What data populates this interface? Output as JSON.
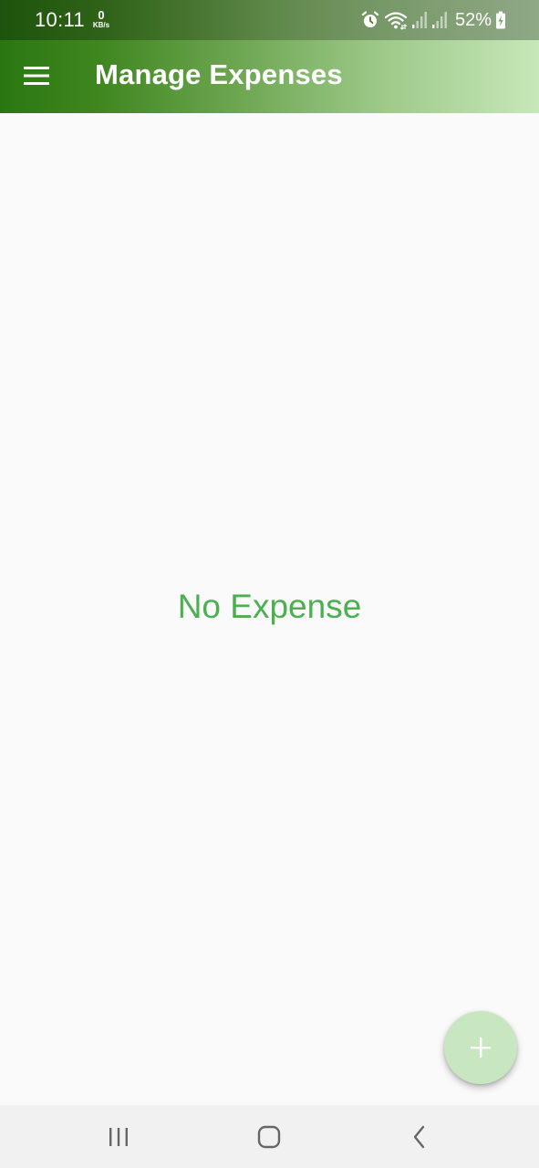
{
  "status_bar": {
    "time": "10:11",
    "net_speed_value": "0",
    "net_speed_unit": "KB/s",
    "battery_percent": "52%",
    "icons": [
      "alarm-icon",
      "wifi-icon",
      "signal-icon",
      "signal-icon",
      "battery-charging-icon"
    ]
  },
  "app_bar": {
    "title": "Manage Expenses",
    "menu_icon": "hamburger-menu-icon"
  },
  "main": {
    "empty_message": "No Expense"
  },
  "fab": {
    "icon": "plus-icon"
  },
  "nav_bar": {
    "items": [
      "recent-apps-icon",
      "home-icon",
      "back-icon"
    ]
  },
  "colors": {
    "gradient_start": "#2a7712",
    "gradient_end": "#c6e8b9",
    "accent_text": "#4caf50",
    "fab_background": "#c8e6c0",
    "background": "#fafafa"
  }
}
